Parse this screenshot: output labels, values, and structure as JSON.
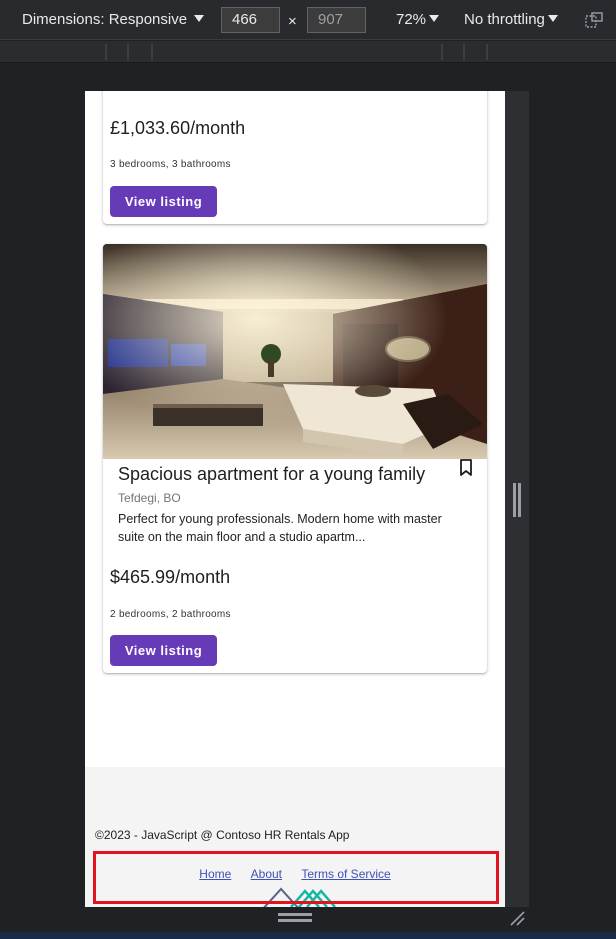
{
  "devtools": {
    "dimensions_label": "Dimensions: Responsive",
    "width_value": "466",
    "height_value": "907",
    "times_symbol": "×",
    "zoom_label": "72%",
    "throttling_label": "No throttling",
    "icons": [
      "caret-down-icon",
      "rotate-icon",
      "resize-handle-icon"
    ]
  },
  "listings": [
    {
      "price": "£1,033.60/month",
      "rooms": "3 bedrooms, 3 bathrooms",
      "button_label": "View listing"
    },
    {
      "title": "Spacious apartment for a young family",
      "location": "Tefdegi, BO",
      "description": "Perfect for young professionals. Modern home with master suite on the main floor and a studio apartm...",
      "price": "$465.99/month",
      "rooms": "2 bedrooms, 2 bathrooms",
      "button_label": "View listing"
    }
  ],
  "footer": {
    "copyright": "©2023 - JavaScript @ Contoso HR Rentals App",
    "links": [
      "Home",
      "About",
      "Terms of Service"
    ]
  },
  "colors": {
    "accent": "#673ab7",
    "link": "#3f51b5",
    "highlight": "#e0141e"
  }
}
